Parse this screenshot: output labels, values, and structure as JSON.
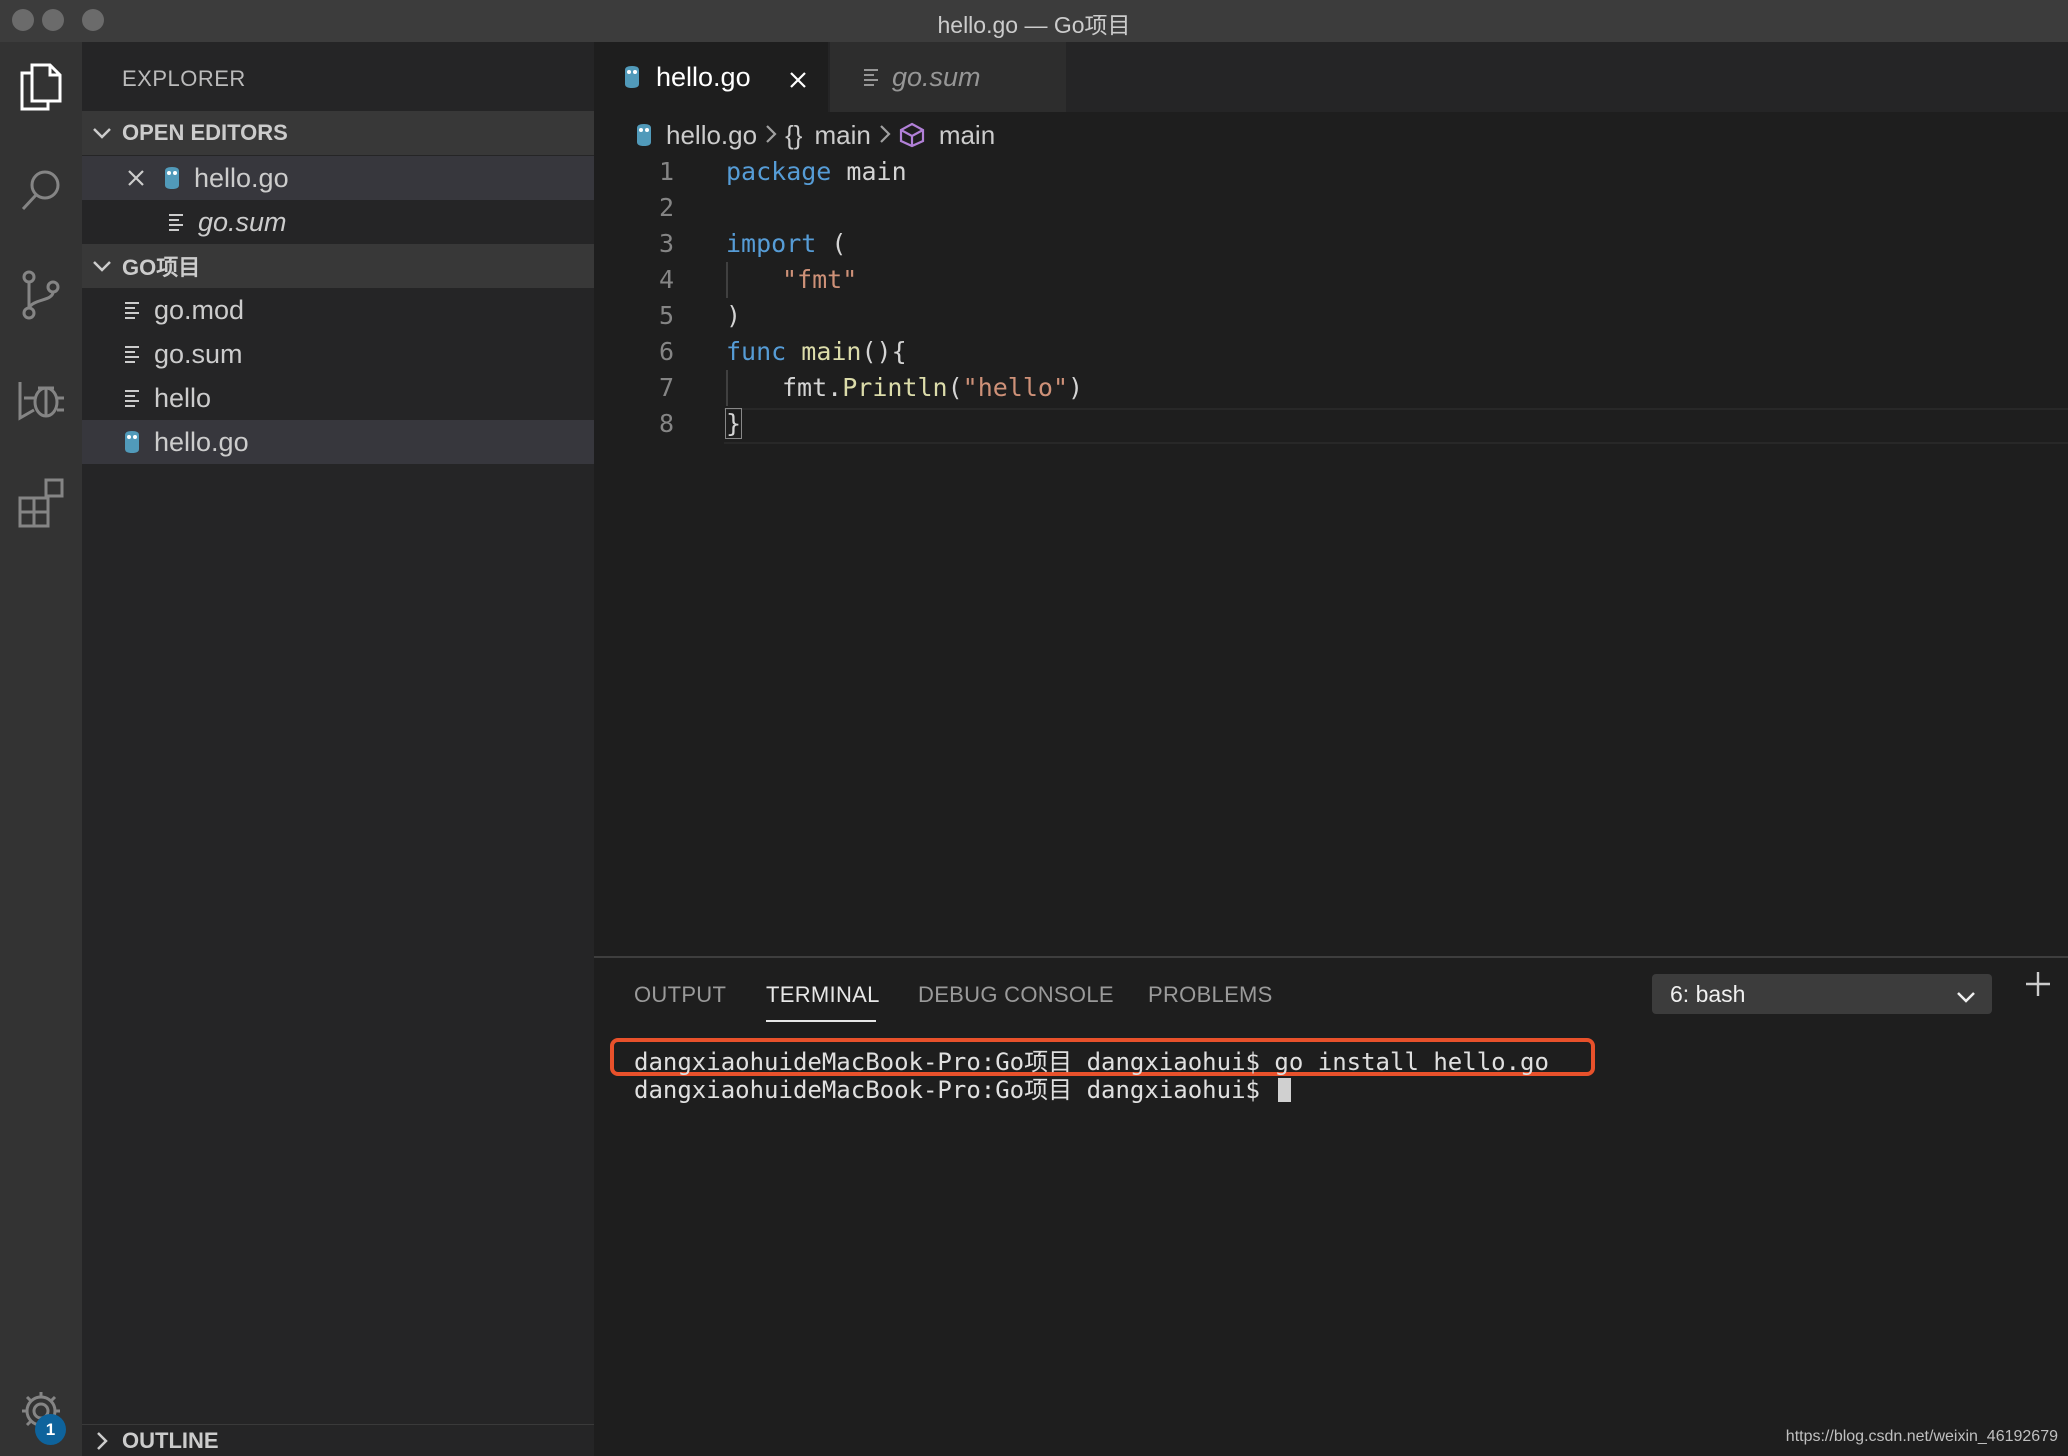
{
  "window": {
    "title": "hello.go — Go项目"
  },
  "sidebar": {
    "title": "EXPLORER",
    "open_editors": {
      "header": "OPEN EDITORS",
      "items": [
        {
          "name": "hello.go"
        },
        {
          "name": "go.sum"
        }
      ]
    },
    "project": {
      "header": "GO项目",
      "files": [
        {
          "name": "go.mod"
        },
        {
          "name": "go.sum"
        },
        {
          "name": "hello"
        },
        {
          "name": "hello.go"
        }
      ]
    },
    "outline_label": "OUTLINE"
  },
  "tabs": [
    {
      "label": "hello.go"
    },
    {
      "label": "go.sum"
    }
  ],
  "breadcrumb": {
    "file": "hello.go",
    "scope": "main",
    "symbol": "main"
  },
  "code": {
    "line_numbers": [
      "1",
      "2",
      "3",
      "4",
      "5",
      "6",
      "7",
      "8"
    ],
    "l1_kw": "package",
    "l1_rest": " main",
    "l3_kw": "import",
    "l3_rest": " (",
    "l4_str": "\"fmt\"",
    "l5": ")",
    "l6_kw": "func",
    "l6_fn": " main",
    "l6_rest": "(){",
    "l7_pre": "fmt.",
    "l7_fn": "Println",
    "l7_open": "(",
    "l7_str": "\"hello\"",
    "l7_close": ")",
    "l8": "}"
  },
  "panel": {
    "tabs": [
      "OUTPUT",
      "TERMINAL",
      "DEBUG CONSOLE",
      "PROBLEMS"
    ],
    "terminal_select": "6: bash",
    "lines": [
      "dangxiaohuideMacBook-Pro:Go项目 dangxiaohui$ go install hello.go",
      "dangxiaohuideMacBook-Pro:Go项目 dangxiaohui$ "
    ]
  },
  "settings_badge": "1",
  "watermark": "https://blog.csdn.net/weixin_46192679",
  "colors": {
    "go_icon": "#519aba",
    "accent": "#0e639c",
    "highlight": "#e8512b"
  }
}
